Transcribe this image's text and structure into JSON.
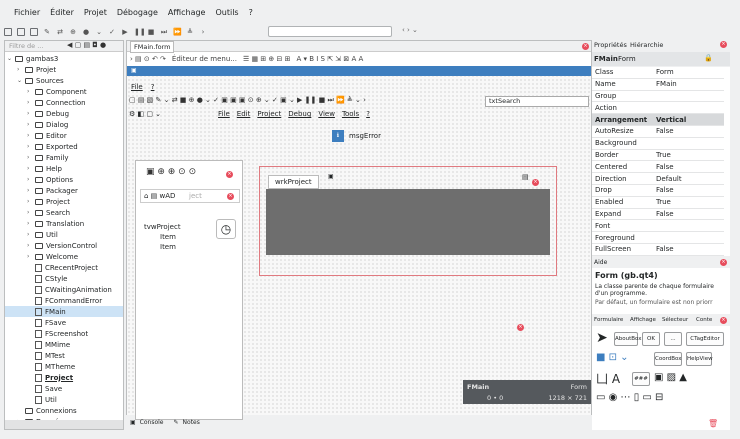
{
  "menu": [
    "Fichier",
    "Éditer",
    "Projet",
    "Débogage",
    "Affichage",
    "Outils",
    "?"
  ],
  "search": {
    "placeholder": "Q",
    "value": ""
  },
  "left_panel": {
    "filter_placeholder": "Filtre de ...",
    "tree": [
      {
        "label": "gambas3",
        "level": 0,
        "arrow": "⌄",
        "type": "root"
      },
      {
        "label": "Projet",
        "level": 1,
        "arrow": "›",
        "type": "folder"
      },
      {
        "label": "Sources",
        "level": 1,
        "arrow": "⌄",
        "type": "folder"
      },
      {
        "label": "Component",
        "level": 2,
        "arrow": "›",
        "type": "folder"
      },
      {
        "label": "Connection",
        "level": 2,
        "arrow": "›",
        "type": "folder"
      },
      {
        "label": "Debug",
        "level": 2,
        "arrow": "›",
        "type": "folder"
      },
      {
        "label": "Dialog",
        "level": 2,
        "arrow": "›",
        "type": "folder"
      },
      {
        "label": "Editor",
        "level": 2,
        "arrow": "›",
        "type": "folder"
      },
      {
        "label": "Exported",
        "level": 2,
        "arrow": "›",
        "type": "folder"
      },
      {
        "label": "Family",
        "level": 2,
        "arrow": "›",
        "type": "folder"
      },
      {
        "label": "Help",
        "level": 2,
        "arrow": "›",
        "type": "folder"
      },
      {
        "label": "Options",
        "level": 2,
        "arrow": "›",
        "type": "folder"
      },
      {
        "label": "Packager",
        "level": 2,
        "arrow": "›",
        "type": "folder"
      },
      {
        "label": "Project",
        "level": 2,
        "arrow": "›",
        "type": "folder"
      },
      {
        "label": "Search",
        "level": 2,
        "arrow": "›",
        "type": "folder"
      },
      {
        "label": "Translation",
        "level": 2,
        "arrow": "›",
        "type": "folder"
      },
      {
        "label": "Util",
        "level": 2,
        "arrow": "›",
        "type": "folder"
      },
      {
        "label": "VersionControl",
        "level": 2,
        "arrow": "›",
        "type": "folder"
      },
      {
        "label": "Welcome",
        "level": 2,
        "arrow": "›",
        "type": "folder"
      },
      {
        "label": "CRecentProject",
        "level": 2,
        "arrow": "",
        "type": "class"
      },
      {
        "label": "CStyle",
        "level": 2,
        "arrow": "",
        "type": "class"
      },
      {
        "label": "CWaitingAnimation",
        "level": 2,
        "arrow": "",
        "type": "class"
      },
      {
        "label": "FCommandError",
        "level": 2,
        "arrow": "",
        "type": "form"
      },
      {
        "label": "FMain",
        "level": 2,
        "arrow": "",
        "type": "form",
        "selected": true
      },
      {
        "label": "FSave",
        "level": 2,
        "arrow": "",
        "type": "form"
      },
      {
        "label": "FScreenshot",
        "level": 2,
        "arrow": "",
        "type": "form"
      },
      {
        "label": "MMime",
        "level": 2,
        "arrow": "",
        "type": "module"
      },
      {
        "label": "MTest",
        "level": 2,
        "arrow": "",
        "type": "module"
      },
      {
        "label": "MTheme",
        "level": 2,
        "arrow": "",
        "type": "module"
      },
      {
        "label": "Project",
        "level": 2,
        "arrow": "",
        "type": "module",
        "bold": true
      },
      {
        "label": "Save",
        "level": 2,
        "arrow": "",
        "type": "module"
      },
      {
        "label": "Util",
        "level": 2,
        "arrow": "",
        "type": "module"
      },
      {
        "label": "Connexions",
        "level": 1,
        "arrow": "",
        "type": "folder"
      },
      {
        "label": "Données",
        "level": 1,
        "arrow": "›",
        "type": "folder"
      }
    ]
  },
  "editor": {
    "tab_label": "FMain.form",
    "toolbar_label": "Éditeur de menu...",
    "form_menu": [
      "File",
      "?"
    ],
    "form_menu2": [
      "File",
      "Edit",
      "Project",
      "Debug",
      "View",
      "Tools",
      "?"
    ],
    "txt_search": "txtSearch",
    "msg_error": "msgError",
    "wrk_tab": "wrkProject",
    "search_placeholder": "ject",
    "tree_root": "tvwProject",
    "tree_items": [
      "Item",
      "Item"
    ],
    "status_name": "FMain",
    "status_type": "Form",
    "status_pos": "0 • 0",
    "status_size": "1218 × 721"
  },
  "bottom_tabs": [
    "Console",
    "Notes"
  ],
  "properties": {
    "tabs": [
      "Propriétés",
      "Hiérarchie"
    ],
    "header_name": "FMain",
    "header_type": "Form",
    "rows": [
      {
        "k": "Class",
        "v": "Form"
      },
      {
        "k": "Name",
        "v": "FMain"
      },
      {
        "k": "Group",
        "v": ""
      },
      {
        "k": "Action",
        "v": ""
      },
      {
        "k": "Arrangement",
        "v": "Vertical",
        "bold": true
      },
      {
        "k": "AutoResize",
        "v": "False"
      },
      {
        "k": "Background",
        "v": ""
      },
      {
        "k": "Border",
        "v": "True"
      },
      {
        "k": "Centered",
        "v": "False"
      },
      {
        "k": "Direction",
        "v": "Default"
      },
      {
        "k": "Drop",
        "v": "False"
      },
      {
        "k": "Enabled",
        "v": "True"
      },
      {
        "k": "Expand",
        "v": "False"
      },
      {
        "k": "Font",
        "v": ""
      },
      {
        "k": "Foreground",
        "v": ""
      },
      {
        "k": "FullScreen",
        "v": "False"
      }
    ]
  },
  "help": {
    "title": "Aide",
    "heading": "Form (gb.qt4)",
    "text": "La classe parente de chaque formulaire d'un programme.",
    "note": "Par défaut, un formulaire est non priorr"
  },
  "toolbox": {
    "tabs": [
      "Formulaire",
      "Affichage",
      "Sélecteur",
      "Conte"
    ],
    "items": [
      "AboutBox",
      "OK",
      "...",
      "CTagEditor",
      "CoordBox",
      "HelpView",
      "###"
    ]
  }
}
